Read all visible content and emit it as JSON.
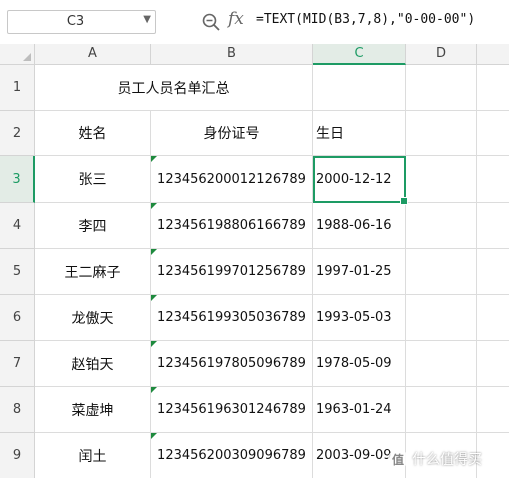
{
  "name_box": {
    "value": "C3",
    "dropdown_icon": "chevron-down-icon"
  },
  "toolbar": {
    "zoom_icon": "zoom-icon",
    "fx_label": "fx"
  },
  "formula": "=TEXT(MID(B3,7,8),\"0-00-00\")",
  "columns": [
    "A",
    "B",
    "C",
    "D"
  ],
  "active_column": "C",
  "active_row": "3",
  "rows": [
    {
      "num": "1",
      "a": "员工人员名单汇总",
      "b": "",
      "c": ""
    },
    {
      "num": "2",
      "a": "姓名",
      "b": "身份证号",
      "c": "生日"
    },
    {
      "num": "3",
      "a": "张三",
      "b": "123456200012126789",
      "c": "2000-12-12"
    },
    {
      "num": "4",
      "a": "李四",
      "b": "123456198806166789",
      "c": "1988-06-16"
    },
    {
      "num": "5",
      "a": "王二麻子",
      "b": "123456199701256789",
      "c": "1997-01-25"
    },
    {
      "num": "6",
      "a": "龙傲天",
      "b": "123456199305036789",
      "c": "1993-05-03"
    },
    {
      "num": "7",
      "a": "赵铂天",
      "b": "123456197805096789",
      "c": "1978-05-09"
    },
    {
      "num": "8",
      "a": "菜虚坤",
      "b": "123456196301246789",
      "c": "1963-01-24"
    },
    {
      "num": "9",
      "a": "闰土",
      "b": "123456200309096789",
      "c": "2003-09-09"
    }
  ],
  "watermark": {
    "badge": "值",
    "text": "什么值得买"
  },
  "colors": {
    "accent": "#1d9b64",
    "header_bg": "#f3f3f3",
    "grid": "#dcdcdc"
  }
}
